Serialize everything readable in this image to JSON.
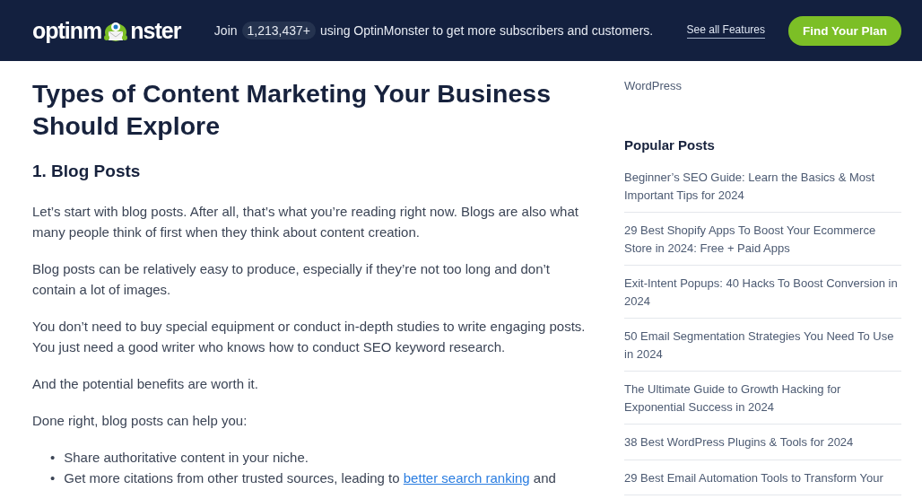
{
  "header": {
    "logo": {
      "before": "optinm",
      "after": "nster"
    },
    "join": {
      "prefix": "Join",
      "count": "1,213,437+",
      "suffix": "using OptinMonster to get more subscribers and customers."
    },
    "features_link": "See all Features",
    "cta": "Find Your Plan"
  },
  "article": {
    "title": "Types of Content Marketing Your Business Should Explore",
    "section": "1. Blog Posts",
    "paragraphs": [
      "Let’s start with blog posts. After all, that’s what you’re reading right now. Blogs are also what many people think of first when they think about content creation.",
      "Blog posts can be relatively easy to produce, especially if they’re not too long and don’t contain a lot of images.",
      "You don’t need to buy special equipment or conduct in-depth studies to write engaging posts. You just need a good writer who knows how to conduct SEO keyword research.",
      "And the potential benefits are worth it.",
      "Done right, blog posts can help you:"
    ],
    "bullets": [
      {
        "marker": "•",
        "text": "Share authoritative content in your niche."
      },
      {
        "marker": "•",
        "text": "Get more citations from other trusted sources, leading to",
        "link": "better search ranking",
        "after": "and"
      }
    ]
  },
  "sidebar": {
    "top_link": "WordPress",
    "heading": "Popular Posts",
    "posts": [
      "Beginner’s SEO Guide: Learn the Basics & Most Important Tips for 2024",
      "29 Best Shopify Apps To Boost Your Ecommerce Store in 2024: Free + Paid Apps",
      "Exit-Intent Popups: 40 Hacks To Boost Conversion in 2024",
      "50 Email Segmentation Strategies You Need To Use in 2024",
      "The Ultimate Guide to Growth Hacking for Exponential Success in 2024",
      "38 Best WordPress Plugins & Tools for 2024",
      "29 Best Email Automation Tools to Transform Your"
    ]
  }
}
